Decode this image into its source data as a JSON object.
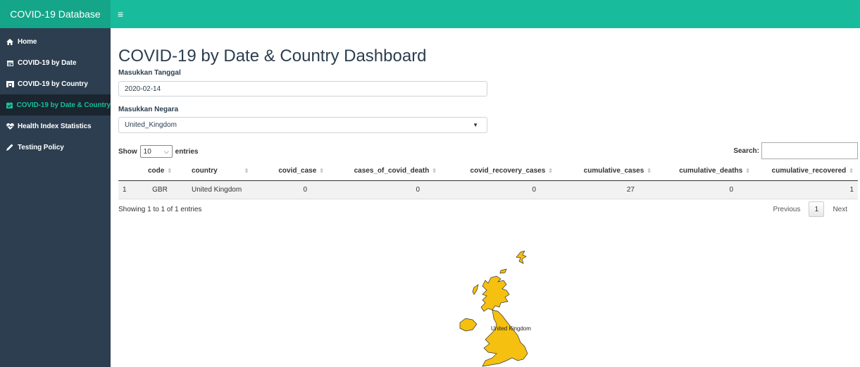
{
  "app": {
    "title": "COVID-19 Database",
    "toggle_icon": "hamburger-icon"
  },
  "sidebar": {
    "items": [
      {
        "label": "Home",
        "icon": "home-icon",
        "active": false
      },
      {
        "label": "COVID-19 by Date",
        "icon": "calendar-icon",
        "active": false
      },
      {
        "label": "COVID-19 by Country",
        "icon": "map-icon",
        "active": false
      },
      {
        "label": "COVID-19 by Date & Country",
        "icon": "calendar-check-icon",
        "active": true
      },
      {
        "label": "Health Index Statistics",
        "icon": "heartbeat-icon",
        "active": false
      },
      {
        "label": "Testing Policy",
        "icon": "pen-icon",
        "active": false
      }
    ]
  },
  "main": {
    "title": "COVID-19 by Date & Country Dashboard",
    "date_label": "Masukkan Tanggal",
    "date_value": "2020-02-14",
    "country_label": "Masukkan Negara",
    "country_value": "United_Kingdom"
  },
  "table": {
    "show_label": "Show",
    "entries_value": "10",
    "entries_label": "entries",
    "search_label": "Search:",
    "columns": [
      "",
      "code",
      "country",
      "covid_case",
      "cases_of_covid_death",
      "covid_recovery_cases",
      "cumulative_cases",
      "cumulative_deaths",
      "cumulative_recovered"
    ],
    "rows": [
      [
        "1",
        "GBR",
        "United Kingdom",
        "0",
        "0",
        "0",
        "27",
        "0",
        "1"
      ]
    ],
    "info": "Showing 1 to 1 of 1 entries",
    "previous": "Previous",
    "current_page": "1",
    "next": "Next"
  },
  "map": {
    "label": "United Kingdom",
    "fill_color": "#f5c00f"
  }
}
